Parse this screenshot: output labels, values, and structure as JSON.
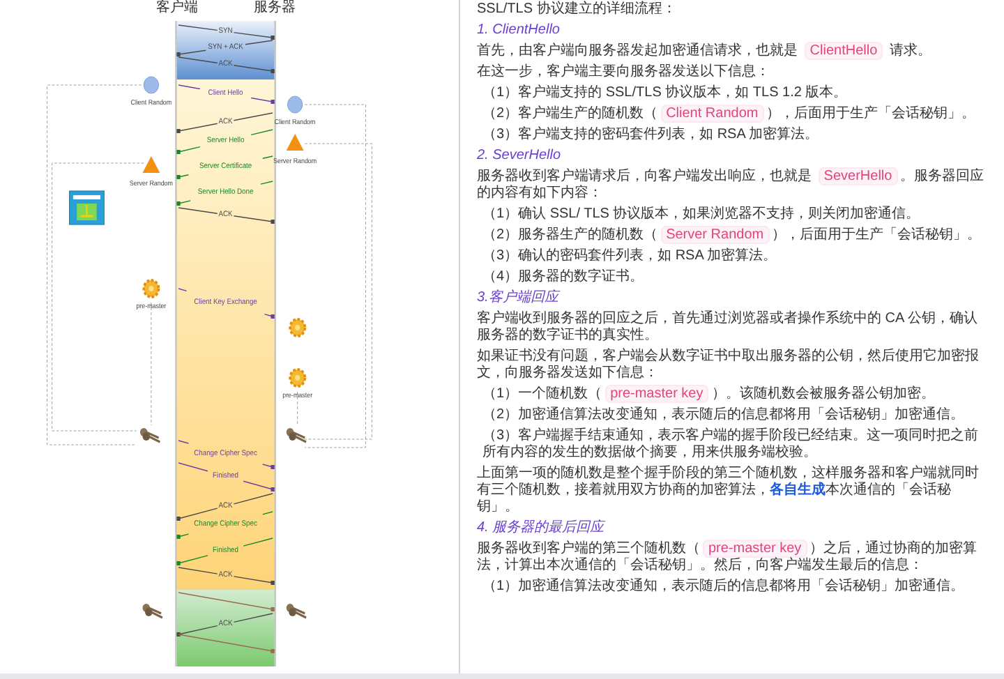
{
  "diagram": {
    "client_label": "客户端",
    "server_label": "服务器",
    "messages": [
      {
        "label": "SYN",
        "to_server": true,
        "kind": "ack"
      },
      {
        "label": "SYN + ACK",
        "to_server": false,
        "kind": "ack"
      },
      {
        "label": "ACK",
        "to_server": true,
        "kind": "ack"
      },
      {
        "label": "Client Hello",
        "to_server": true,
        "kind": "client"
      },
      {
        "label": "ACK",
        "to_server": false,
        "kind": "ack"
      },
      {
        "label": "Server Hello",
        "to_server": false,
        "kind": "server"
      },
      {
        "label": "Server Certificate",
        "to_server": false,
        "kind": "server"
      },
      {
        "label": "Server Hello Done",
        "to_server": false,
        "kind": "server"
      },
      {
        "label": "ACK",
        "to_server": true,
        "kind": "ack"
      },
      {
        "label": "Client Key Exchange",
        "to_server": true,
        "kind": "client"
      },
      {
        "label": "Change Cipher Spec",
        "to_server": true,
        "kind": "client"
      },
      {
        "label": "Finished",
        "to_server": true,
        "kind": "client"
      },
      {
        "label": "ACK",
        "to_server": false,
        "kind": "ack"
      },
      {
        "label": "Change Cipher Spec",
        "to_server": false,
        "kind": "server"
      },
      {
        "label": "Finished",
        "to_server": false,
        "kind": "server"
      },
      {
        "label": "ACK",
        "to_server": true,
        "kind": "ack"
      },
      {
        "to_server": true,
        "kind": "data"
      },
      {
        "label": "ACK",
        "to_server": false,
        "kind": "ack"
      },
      {
        "to_server": true,
        "kind": "data"
      }
    ],
    "side_items": [
      {
        "kind": "circle",
        "label": "Client Random"
      },
      {
        "kind": "circle",
        "label": "Client Random"
      },
      {
        "kind": "triangle",
        "label": "Server Random"
      },
      {
        "kind": "triangle",
        "label": "Server Random"
      },
      {
        "kind": "certificate"
      },
      {
        "kind": "gear",
        "label": "pre-master"
      },
      {
        "kind": "gear"
      },
      {
        "kind": "gear",
        "label": "pre-master"
      },
      {
        "kind": "key"
      },
      {
        "kind": "key"
      },
      {
        "kind": "key"
      },
      {
        "kind": "key"
      }
    ]
  },
  "article": [
    {
      "kind": "text",
      "parts": [
        {
          "t": "SSL/TLS 协议建立的详细流程："
        }
      ]
    },
    {
      "kind": "heading",
      "parts": [
        {
          "t": "1. ClientHello"
        }
      ]
    },
    {
      "kind": "text",
      "parts": [
        {
          "t": "首先，由客户端向服务器发起加密通信请求，也就是 "
        },
        {
          "t": "ClientHello",
          "kind": "code"
        },
        {
          "t": " 请求。"
        }
      ]
    },
    {
      "kind": "text",
      "parts": [
        {
          "t": "在这一步，客户端主要向服务器发送以下信息："
        }
      ]
    },
    {
      "kind": "item",
      "parts": [
        {
          "t": "（1）客户端支持的 SSL/TLS 协议版本，如 TLS 1.2 版本。"
        }
      ]
    },
    {
      "kind": "item",
      "parts": [
        {
          "t": "（2）客户端生产的随机数（"
        },
        {
          "t": "Client Random",
          "kind": "code"
        },
        {
          "t": "），后面用于生产「会话秘钥」。"
        }
      ]
    },
    {
      "kind": "item",
      "parts": [
        {
          "t": "（3）客户端支持的密码套件列表，如 RSA 加密算法。"
        }
      ]
    },
    {
      "kind": "heading",
      "parts": [
        {
          "t": "2. SeverHello"
        }
      ]
    },
    {
      "kind": "text",
      "parts": [
        {
          "t": "服务器收到客户端请求后，向客户端发出响应，也就是 "
        },
        {
          "t": "SeverHello",
          "kind": "code"
        },
        {
          "t": "。服务器回应的内容有如下内容："
        }
      ]
    },
    {
      "kind": "item",
      "parts": [
        {
          "t": "（1）确认 SSL/ TLS 协议版本，如果浏览器不支持，则关闭加密通信。"
        }
      ]
    },
    {
      "kind": "item",
      "parts": [
        {
          "t": "（2）服务器生产的随机数（"
        },
        {
          "t": "Server Random",
          "kind": "code"
        },
        {
          "t": "），后面用于生产「会话秘钥」。"
        }
      ]
    },
    {
      "kind": "item",
      "parts": [
        {
          "t": "（3）确认的密码套件列表，如 RSA 加密算法。"
        }
      ]
    },
    {
      "kind": "item",
      "parts": [
        {
          "t": "（4）服务器的数字证书。"
        }
      ]
    },
    {
      "kind": "heading",
      "parts": [
        {
          "t": "3.客户端回应"
        }
      ]
    },
    {
      "kind": "text",
      "parts": [
        {
          "t": "客户端收到服务器的回应之后，首先通过浏览器或者操作系统中的 CA 公钥，确认服务器的数字证书的真实性。"
        }
      ]
    },
    {
      "kind": "text",
      "parts": [
        {
          "t": "如果证书没有问题，客户端会从数字证书中取出服务器的公钥，然后使用它加密报文，向服务器发送如下信息："
        }
      ]
    },
    {
      "kind": "item",
      "parts": [
        {
          "t": "（1）一个随机数（"
        },
        {
          "t": "pre-master key",
          "kind": "code"
        },
        {
          "t": "）。该随机数会被服务器公钥加密。"
        }
      ]
    },
    {
      "kind": "item",
      "parts": [
        {
          "t": "（2）加密通信算法改变通知，表示随后的信息都将用「会话秘钥」加密通信。"
        }
      ]
    },
    {
      "kind": "item",
      "parts": [
        {
          "t": "（3）客户端握手结束通知，表示客户端的握手阶段已经结束。这一项同时把之前所有内容的发生的数据做个摘要，用来供服务端校验。"
        }
      ]
    },
    {
      "kind": "text",
      "parts": [
        {
          "t": "上面第一项的随机数是整个握手阶段的第三个随机数，这样服务器和客户端就同时有三个随机数，接着就用双方协商的加密算法，"
        },
        {
          "t": "各自生成",
          "kind": "strong"
        },
        {
          "t": "本次通信的「会话秘钥」。"
        }
      ]
    },
    {
      "kind": "heading",
      "parts": [
        {
          "t": "4. 服务器的最后回应"
        }
      ]
    },
    {
      "kind": "text",
      "parts": [
        {
          "t": "服务器收到客户端的第三个随机数（"
        },
        {
          "t": "pre-master key",
          "kind": "code"
        },
        {
          "t": "）之后，通过协商的加密算法，计算出本次通信的「会话秘钥」。然后，向客户端发生最后的信息："
        }
      ]
    },
    {
      "kind": "item",
      "parts": [
        {
          "t": "（1）加密通信算法改变通知，表示随后的信息都将用「会话秘钥」加密通信。"
        }
      ]
    }
  ]
}
